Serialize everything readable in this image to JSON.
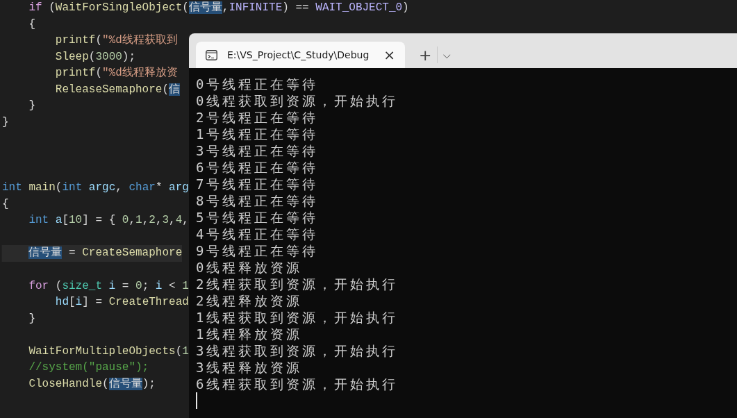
{
  "editor": {
    "lines": [
      {
        "kind": "block",
        "current": false,
        "tokens": [
          {
            "kind": "ctl",
            "text": "if"
          },
          {
            "kind": "p",
            "text": " ("
          },
          {
            "kind": "fn",
            "text": "WaitForSingleObject"
          },
          {
            "kind": "p",
            "text": "("
          },
          {
            "kind": "hl",
            "text": "信号量"
          },
          {
            "kind": "p",
            "text": ","
          },
          {
            "kind": "mac",
            "text": "INFINITE"
          },
          {
            "kind": "p",
            "text": ") == "
          },
          {
            "kind": "mac",
            "text": "WAIT_OBJECT_0"
          },
          {
            "kind": "p",
            "text": ")"
          }
        ]
      },
      {
        "kind": "block",
        "current": false,
        "tokens": [
          {
            "kind": "p",
            "text": "{"
          }
        ]
      },
      {
        "kind": "inner",
        "current": false,
        "tokens": [
          {
            "kind": "fn",
            "text": "printf"
          },
          {
            "kind": "p",
            "text": "("
          },
          {
            "kind": "str",
            "text": "\"%d线程获取到"
          }
        ]
      },
      {
        "kind": "inner",
        "current": false,
        "tokens": [
          {
            "kind": "fn",
            "text": "Sleep"
          },
          {
            "kind": "p",
            "text": "("
          },
          {
            "kind": "num",
            "text": "3000"
          },
          {
            "kind": "p",
            "text": ");"
          }
        ]
      },
      {
        "kind": "inner",
        "current": false,
        "tokens": [
          {
            "kind": "fn",
            "text": "printf"
          },
          {
            "kind": "p",
            "text": "("
          },
          {
            "kind": "str",
            "text": "\"%d线程释放资"
          }
        ]
      },
      {
        "kind": "inner",
        "current": false,
        "tokens": [
          {
            "kind": "fn",
            "text": "ReleaseSemaphore"
          },
          {
            "kind": "p",
            "text": "("
          },
          {
            "kind": "hl",
            "text": "信"
          }
        ]
      },
      {
        "kind": "block",
        "current": false,
        "tokens": [
          {
            "kind": "p",
            "text": "}"
          }
        ]
      },
      {
        "kind": "top",
        "current": false,
        "tokens": [
          {
            "kind": "p",
            "text": "}"
          }
        ]
      },
      {
        "kind": "blank"
      },
      {
        "kind": "blank"
      },
      {
        "kind": "blank"
      },
      {
        "kind": "top",
        "current": false,
        "tokens": [
          {
            "kind": "kw",
            "text": "int"
          },
          {
            "kind": "fn",
            "text": " main"
          },
          {
            "kind": "p",
            "text": "("
          },
          {
            "kind": "kw",
            "text": "int"
          },
          {
            "kind": "var",
            "text": " argc"
          },
          {
            "kind": "p",
            "text": ", "
          },
          {
            "kind": "kw",
            "text": "char"
          },
          {
            "kind": "p",
            "text": "* "
          },
          {
            "kind": "var",
            "text": "arg"
          }
        ]
      },
      {
        "kind": "top",
        "current": false,
        "tokens": [
          {
            "kind": "p",
            "text": "{"
          }
        ]
      },
      {
        "kind": "block",
        "current": false,
        "tokens": [
          {
            "kind": "kw",
            "text": "int"
          },
          {
            "kind": "var",
            "text": " a"
          },
          {
            "kind": "p",
            "text": "["
          },
          {
            "kind": "num",
            "text": "10"
          },
          {
            "kind": "p",
            "text": "] = { "
          },
          {
            "kind": "num",
            "text": "0"
          },
          {
            "kind": "p",
            "text": ","
          },
          {
            "kind": "num",
            "text": "1"
          },
          {
            "kind": "p",
            "text": ","
          },
          {
            "kind": "num",
            "text": "2"
          },
          {
            "kind": "p",
            "text": ","
          },
          {
            "kind": "num",
            "text": "3"
          },
          {
            "kind": "p",
            "text": ","
          },
          {
            "kind": "num",
            "text": "4"
          },
          {
            "kind": "p",
            "text": ","
          }
        ]
      },
      {
        "kind": "blank"
      },
      {
        "kind": "block",
        "current": true,
        "tokens": [
          {
            "kind": "hl",
            "text": "信号量"
          },
          {
            "kind": "p",
            "text": " = "
          },
          {
            "kind": "fn",
            "text": "CreateSemaphore"
          }
        ]
      },
      {
        "kind": "blank"
      },
      {
        "kind": "block",
        "current": false,
        "tokens": [
          {
            "kind": "ctl",
            "text": "for"
          },
          {
            "kind": "p",
            "text": " ("
          },
          {
            "kind": "type",
            "text": "size_t"
          },
          {
            "kind": "var",
            "text": " i"
          },
          {
            "kind": "p",
            "text": " = "
          },
          {
            "kind": "num",
            "text": "0"
          },
          {
            "kind": "p",
            "text": "; "
          },
          {
            "kind": "var",
            "text": "i"
          },
          {
            "kind": "p",
            "text": " < "
          },
          {
            "kind": "num",
            "text": "1"
          }
        ]
      },
      {
        "kind": "inner",
        "current": false,
        "tokens": [
          {
            "kind": "var",
            "text": "hd"
          },
          {
            "kind": "p",
            "text": "["
          },
          {
            "kind": "var",
            "text": "i"
          },
          {
            "kind": "p",
            "text": "] = "
          },
          {
            "kind": "fn",
            "text": "CreateThread"
          }
        ]
      },
      {
        "kind": "block",
        "current": false,
        "tokens": [
          {
            "kind": "p",
            "text": "}"
          }
        ]
      },
      {
        "kind": "blank"
      },
      {
        "kind": "block",
        "current": false,
        "tokens": [
          {
            "kind": "fn",
            "text": "WaitForMultipleObjects"
          },
          {
            "kind": "p",
            "text": "("
          },
          {
            "kind": "num",
            "text": "1"
          }
        ]
      },
      {
        "kind": "block",
        "current": false,
        "tokens": [
          {
            "kind": "cmt",
            "text": "//system(\"pause\");"
          }
        ]
      },
      {
        "kind": "block",
        "current": false,
        "tokens": [
          {
            "kind": "fn",
            "text": "CloseHandle"
          },
          {
            "kind": "p",
            "text": "("
          },
          {
            "kind": "hl",
            "text": "信号量"
          },
          {
            "kind": "p",
            "text": ");"
          }
        ]
      }
    ]
  },
  "terminal": {
    "tab": {
      "title": "E:\\VS_Project\\C_Study\\Debug",
      "close": "×",
      "selected": true
    },
    "new_tab": "+",
    "dropdown": "⌵",
    "output": [
      "0号线程正在等待",
      "0线程获取到资源，开始执行",
      "2号线程正在等待",
      "1号线程正在等待",
      "3号线程正在等待",
      "6号线程正在等待",
      "7号线程正在等待",
      "8号线程正在等待",
      "5号线程正在等待",
      "4号线程正在等待",
      "9号线程正在等待",
      "0线程释放资源",
      "2线程获取到资源，开始执行",
      "2线程释放资源",
      "1线程获取到资源，开始执行",
      "1线程释放资源",
      "3线程获取到资源，开始执行",
      "3线程释放资源",
      "6线程获取到资源，开始执行"
    ]
  }
}
